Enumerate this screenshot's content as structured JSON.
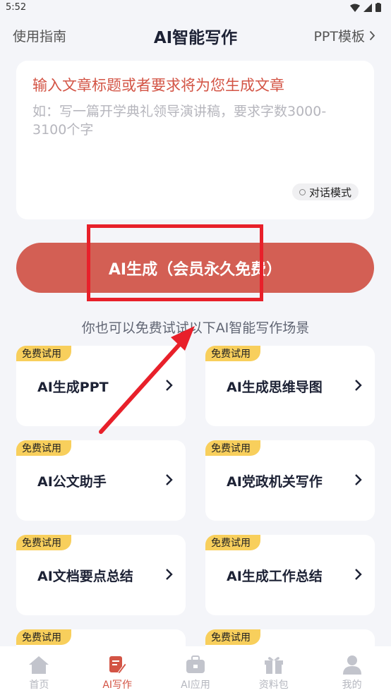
{
  "status": {
    "time": "5:52"
  },
  "header": {
    "guide": "使用指南",
    "title": "AI智能写作",
    "ppt": "PPT模板"
  },
  "input": {
    "hint": "输入文章标题或者要求将为您生成文章",
    "example": "如：写一篇开学典礼领导演讲稿，要求字数3000-3100个字",
    "chat_mode": "对话模式"
  },
  "generate": {
    "label": "AI生成（会员永久免费）"
  },
  "scenes": {
    "label": "你也可以免费试试以下AI智能写作场景",
    "badge": "免费试用",
    "items": [
      {
        "label": "AI生成PPT"
      },
      {
        "label": "AI生成思维导图"
      },
      {
        "label": "AI公文助手"
      },
      {
        "label": "AI党政机关写作"
      },
      {
        "label": "AI文档要点总结"
      },
      {
        "label": "AI生成工作总结"
      },
      {
        "label": ""
      },
      {
        "label": ""
      }
    ]
  },
  "tabs": [
    {
      "label": "首页",
      "icon": "home-icon"
    },
    {
      "label": "AI写作",
      "icon": "write-icon"
    },
    {
      "label": "AI应用",
      "icon": "toolbox-icon"
    },
    {
      "label": "资料包",
      "icon": "gift-icon"
    },
    {
      "label": "我的",
      "icon": "person-icon"
    }
  ],
  "colors": {
    "accent": "#d35445",
    "button": "#d35f54",
    "badge": "#f8cf5c",
    "annotation": "#e8202a"
  }
}
